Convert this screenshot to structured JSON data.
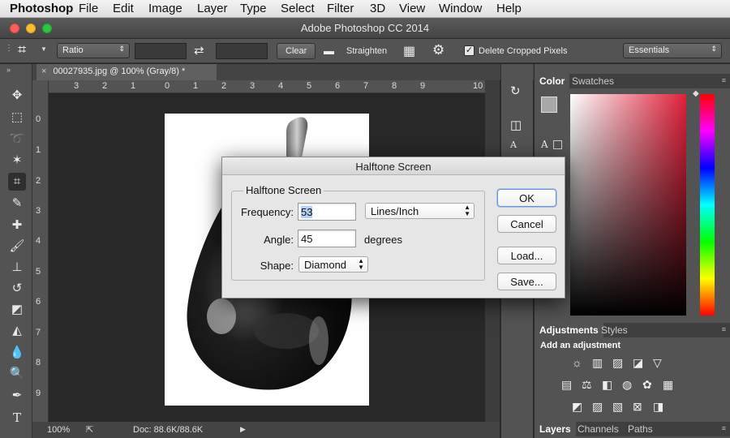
{
  "menubar": {
    "app": "Photoshop",
    "items": [
      "File",
      "Edit",
      "Image",
      "Layer",
      "Type",
      "Select",
      "Filter",
      "3D",
      "View",
      "Window",
      "Help"
    ]
  },
  "window": {
    "title": "Adobe Photoshop CC 2014"
  },
  "options": {
    "ratio": "Ratio",
    "clear": "Clear",
    "straighten": "Straighten",
    "delete_cropped": "Delete Cropped Pixels",
    "delete_cropped_checked": true,
    "workspace": "Essentials"
  },
  "document": {
    "tab_title": "00027935.jpg @ 100% (Gray/8) *",
    "ruler_top": [
      "3",
      "2",
      "1",
      "0",
      "1",
      "2",
      "3",
      "4",
      "5",
      "6",
      "7",
      "8",
      "9",
      "10"
    ],
    "ruler_left": [
      "0",
      "1",
      "2",
      "3",
      "4",
      "5",
      "6",
      "7",
      "8",
      "9"
    ]
  },
  "status": {
    "zoom": "100%",
    "doc": "Doc: 88.6K/88.6K"
  },
  "panels": {
    "color_tabs": [
      "Color",
      "Swatches"
    ],
    "adjust_tabs": [
      "Adjustments",
      "Styles"
    ],
    "adjust_heading": "Add an adjustment",
    "layer_tabs": [
      "Layers",
      "Channels",
      "Paths"
    ]
  },
  "dialog": {
    "title": "Halftone Screen",
    "group_label": "Halftone Screen",
    "frequency_label": "Frequency:",
    "frequency_value": "53",
    "frequency_unit": "Lines/Inch",
    "angle_label": "Angle:",
    "angle_value": "45",
    "angle_unit": "degrees",
    "shape_label": "Shape:",
    "shape_value": "Diamond",
    "ok": "OK",
    "cancel": "Cancel",
    "load": "Load...",
    "save": "Save..."
  }
}
